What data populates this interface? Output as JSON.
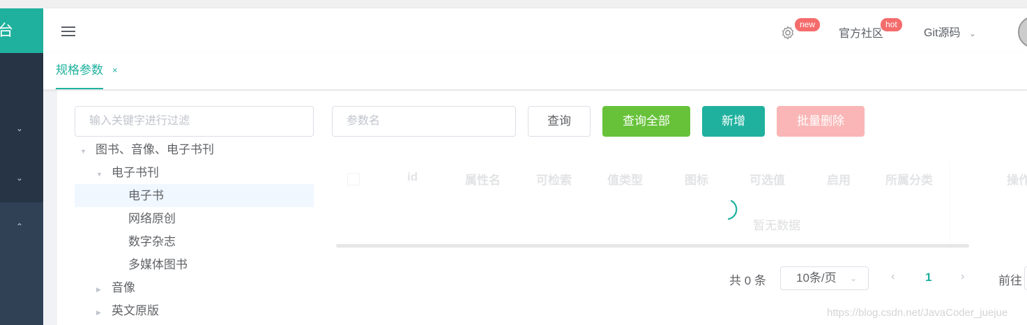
{
  "sidebar": {
    "logo_text": "台",
    "chevrons": [
      "⌄",
      "⌄",
      "⌃"
    ]
  },
  "header": {
    "badge_new": "new",
    "community": "官方社区",
    "badge_hot": "hot",
    "git": "Git源码",
    "git_chevron": "⌄"
  },
  "tags": {
    "active_tag": "规格参数",
    "close": "×"
  },
  "tree": {
    "filter_placeholder": "输入关键字进行过滤",
    "nodes": [
      {
        "label": "图书、音像、电子书刊",
        "arrow": "▼"
      },
      {
        "label": "电子书刊",
        "arrow": "▼"
      },
      {
        "label": "电子书",
        "arrow": ""
      },
      {
        "label": "网络原创",
        "arrow": ""
      },
      {
        "label": "数字杂志",
        "arrow": ""
      },
      {
        "label": "多媒体图书",
        "arrow": ""
      },
      {
        "label": "音像",
        "arrow": "▶"
      },
      {
        "label": "英文原版",
        "arrow": "▶"
      }
    ]
  },
  "toolbar": {
    "param_placeholder": "参数名",
    "query": "查询",
    "query_all": "查询全部",
    "add": "新增",
    "batch_delete": "批量删除"
  },
  "table": {
    "columns": [
      "id",
      "属性名",
      "可检索",
      "值类型",
      "图标",
      "可选值",
      "启用",
      "所属分类",
      "操作"
    ],
    "empty_text": "暂无数据"
  },
  "pagination": {
    "total": "共 0 条",
    "page_size": "10条/页",
    "dropdown_arrow": "⌄",
    "prev": "‹",
    "current_page": "1",
    "next": "›",
    "goto": "前往"
  },
  "watermark": "https://blog.csdn.net/JavaCoder_juejue",
  "colors": {
    "brand": "#1fb19e",
    "sidebar": "#304156",
    "danger": "#f56c6c",
    "success": "#67c23a"
  }
}
